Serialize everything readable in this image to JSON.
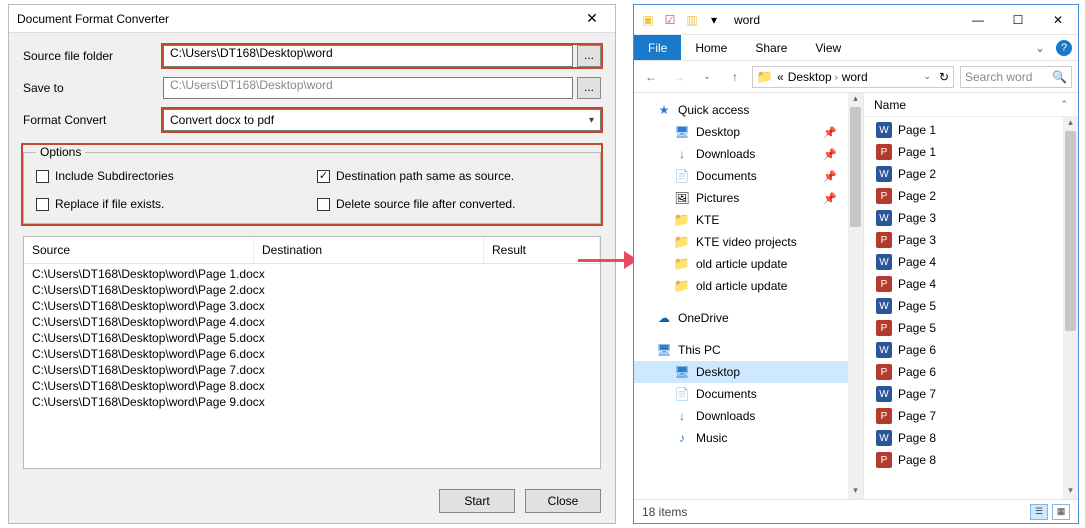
{
  "dialog": {
    "title": "Document Format Converter",
    "labels": {
      "source": "Source file folder",
      "save": "Save to",
      "format": "Format Convert"
    },
    "source_path": "C:\\Users\\DT168\\Desktop\\word",
    "save_path": "C:\\Users\\DT168\\Desktop\\word",
    "browse": "...",
    "format_value": "Convert docx to pdf",
    "options_legend": "Options",
    "opts": {
      "include_sub": "Include Subdirectories",
      "dest_same": "Destination path same as source.",
      "replace": "Replace if file exists.",
      "delete_src": "Delete source file after converted."
    },
    "cols": {
      "src": "Source",
      "dst": "Destination",
      "res": "Result"
    },
    "rows": [
      "C:\\Users\\DT168\\Desktop\\word\\Page 1.docx",
      "C:\\Users\\DT168\\Desktop\\word\\Page 2.docx",
      "C:\\Users\\DT168\\Desktop\\word\\Page 3.docx",
      "C:\\Users\\DT168\\Desktop\\word\\Page 4.docx",
      "C:\\Users\\DT168\\Desktop\\word\\Page 5.docx",
      "C:\\Users\\DT168\\Desktop\\word\\Page 6.docx",
      "C:\\Users\\DT168\\Desktop\\word\\Page 7.docx",
      "C:\\Users\\DT168\\Desktop\\word\\Page 8.docx",
      "C:\\Users\\DT168\\Desktop\\word\\Page 9.docx"
    ],
    "buttons": {
      "start": "Start",
      "close": "Close"
    }
  },
  "explorer": {
    "title": "word",
    "tabs": {
      "file": "File",
      "home": "Home",
      "share": "Share",
      "view": "View"
    },
    "crumbs": {
      "prefix": "«",
      "a": "Desktop",
      "b": "word"
    },
    "search_placeholder": "Search word",
    "tree": {
      "quick": "Quick access",
      "desktop": "Desktop",
      "downloads": "Downloads",
      "documents": "Documents",
      "pictures": "Pictures",
      "kte": "KTE",
      "ktevid": "KTE video projects",
      "old1": "old article update",
      "old2": "old article update",
      "onedrive": "OneDrive",
      "thispc": "This PC",
      "pc_desktop": "Desktop",
      "pc_documents": "Documents",
      "pc_downloads": "Downloads",
      "pc_music": "Music"
    },
    "files_header": "Name",
    "files": [
      {
        "name": "Page 1",
        "type": "docx"
      },
      {
        "name": "Page 1",
        "type": "pdf"
      },
      {
        "name": "Page 2",
        "type": "docx"
      },
      {
        "name": "Page 2",
        "type": "pdf"
      },
      {
        "name": "Page 3",
        "type": "docx"
      },
      {
        "name": "Page 3",
        "type": "pdf"
      },
      {
        "name": "Page 4",
        "type": "docx"
      },
      {
        "name": "Page 4",
        "type": "pdf"
      },
      {
        "name": "Page 5",
        "type": "docx"
      },
      {
        "name": "Page 5",
        "type": "pdf"
      },
      {
        "name": "Page 6",
        "type": "docx"
      },
      {
        "name": "Page 6",
        "type": "pdf"
      },
      {
        "name": "Page 7",
        "type": "docx"
      },
      {
        "name": "Page 7",
        "type": "pdf"
      },
      {
        "name": "Page 8",
        "type": "docx"
      },
      {
        "name": "Page 8",
        "type": "pdf"
      }
    ],
    "status": "18 items"
  }
}
